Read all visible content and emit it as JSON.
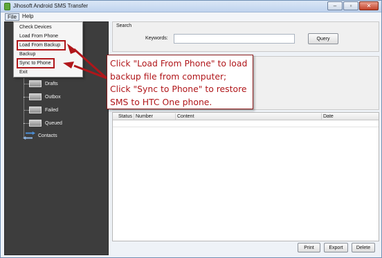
{
  "window": {
    "title": "Jihosoft Android SMS Transfer",
    "icon": "android-app-icon"
  },
  "titlebar_buttons": {
    "minimize": "–",
    "maximize": "▫",
    "close": "✕"
  },
  "menu": {
    "file": "File",
    "help": "Help"
  },
  "file_menu_items": [
    "Check Devices",
    "Load From Phone",
    "Load From Backup",
    "Backup",
    "Sync to Phone",
    "Exit"
  ],
  "sidebar": {
    "items": [
      {
        "label": "Drafts",
        "icon": "sms-folder-icon"
      },
      {
        "label": "Outbox",
        "icon": "sms-folder-icon"
      },
      {
        "label": "Failed",
        "icon": "sms-folder-icon"
      },
      {
        "label": "Queued",
        "icon": "sms-folder-icon"
      },
      {
        "label": "Contacts",
        "icon": "contacts-sync-icon"
      }
    ]
  },
  "search": {
    "title": "Search",
    "keywords_label": "Keywords:",
    "keywords_value": "",
    "query_button": "Query"
  },
  "table": {
    "columns": [
      "Status",
      "Number",
      "Content",
      "Date"
    ],
    "rows": []
  },
  "buttons": {
    "print": "Print",
    "export": "Export",
    "delete": "Delete"
  },
  "callout": {
    "lines": [
      "Click \"Load From Phone\" to load",
      "backup file from computer;",
      "Click \"Sync to Phone\" to restore",
      "SMS to HTC One phone."
    ],
    "color": "#b0161a"
  },
  "colors": {
    "sidebar_bg": "#3d3d3d",
    "highlight": "#b0161a"
  }
}
